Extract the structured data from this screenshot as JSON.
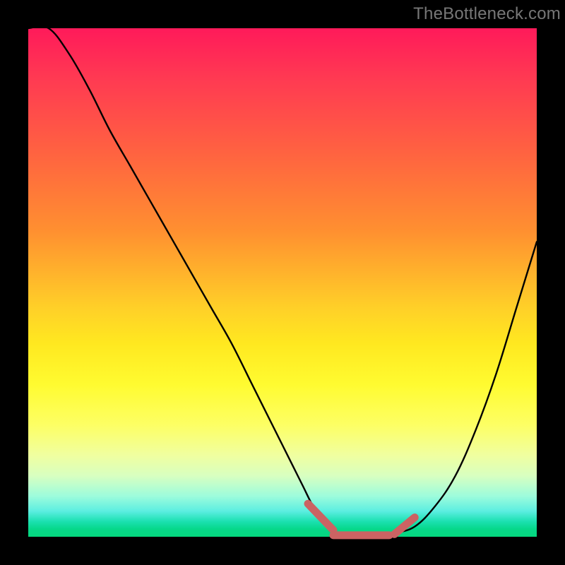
{
  "watermark": "TheBottleneck.com",
  "colors": {
    "frame_bg_top": "#ff1a5a",
    "frame_bg_bottom": "#05d87e",
    "curve": "#000000",
    "marker": "#cb6363"
  },
  "chart_data": {
    "type": "line",
    "title": "",
    "xlabel": "",
    "ylabel": "",
    "xlim": [
      0,
      100
    ],
    "ylim": [
      0,
      100
    ],
    "series": [
      {
        "name": "bottleneck-curve",
        "x": [
          0,
          4,
          8,
          12,
          16,
          20,
          24,
          28,
          32,
          36,
          40,
          44,
          48,
          50,
          52,
          54,
          56,
          58,
          60,
          62,
          64,
          66,
          68,
          70,
          72,
          76,
          80,
          84,
          88,
          92,
          96,
          100
        ],
        "values": [
          100,
          100,
          95,
          88,
          80,
          73,
          66,
          59,
          52,
          45,
          38,
          30,
          22,
          18,
          14,
          10,
          6,
          3,
          1.2,
          0.5,
          0.3,
          0.3,
          0.3,
          0.4,
          0.7,
          2,
          6,
          12,
          21,
          32,
          45,
          58
        ]
      }
    ],
    "markers": [
      {
        "name": "left-marker",
        "x_range": [
          55,
          60
        ],
        "y": 1.5
      },
      {
        "name": "flat-marker",
        "x_range": [
          60,
          71
        ],
        "y": 0.3
      },
      {
        "name": "right-marker",
        "x_range": [
          72,
          76
        ],
        "y": 1.3
      }
    ]
  }
}
